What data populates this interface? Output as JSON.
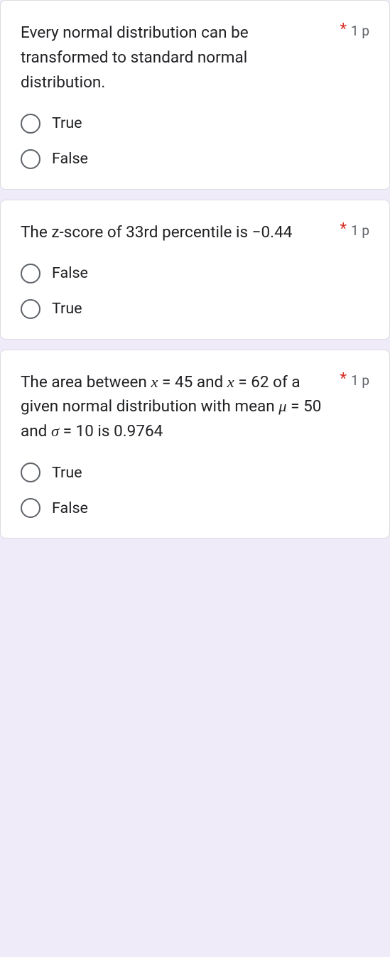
{
  "required_marker": "*",
  "points_label": "1 p",
  "questions": [
    {
      "text": "Every normal distribution can be transformed to standard normal distribution.",
      "options": [
        "True",
        "False"
      ]
    },
    {
      "text": "The z-score of 33rd percentile is −0.44",
      "options": [
        "False",
        "True"
      ]
    },
    {
      "text_parts": {
        "p1": "The area between ",
        "v1": "x",
        "p2": " = 45 and ",
        "v2": "x",
        "p3": " = 62 of a given normal distribution with mean ",
        "v3": "μ",
        "p4": " = 50 and ",
        "v4": "σ",
        "p5": " = 10 is 0.9764"
      },
      "options": [
        "True",
        "False"
      ]
    }
  ]
}
